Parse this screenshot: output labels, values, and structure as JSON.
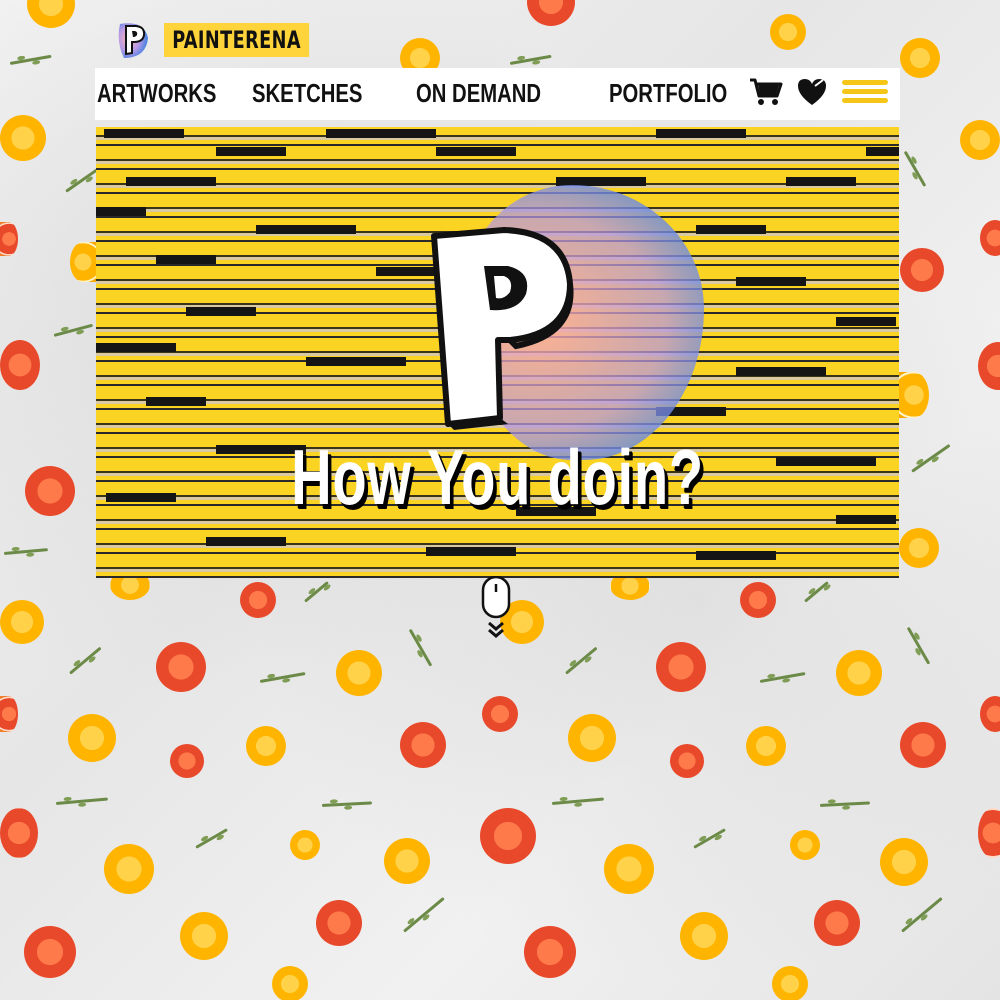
{
  "brand": {
    "name": "PAINTERENA"
  },
  "nav": {
    "items": [
      {
        "label": "ARTWORKS"
      },
      {
        "label": "SKETCHES"
      },
      {
        "label": "ON DEMAND"
      },
      {
        "label": "PORTFOLIO"
      }
    ],
    "icons": [
      "cart-icon",
      "heart-icon",
      "hamburger-menu-icon"
    ]
  },
  "hero": {
    "title": "How You doin?"
  },
  "scroll_hint": {
    "icon": "mouse-scroll-icon"
  },
  "colors": {
    "accent": "#ffd43b",
    "menu": "#f5c518",
    "text": "#111111",
    "blue": "#3d7fe0"
  }
}
